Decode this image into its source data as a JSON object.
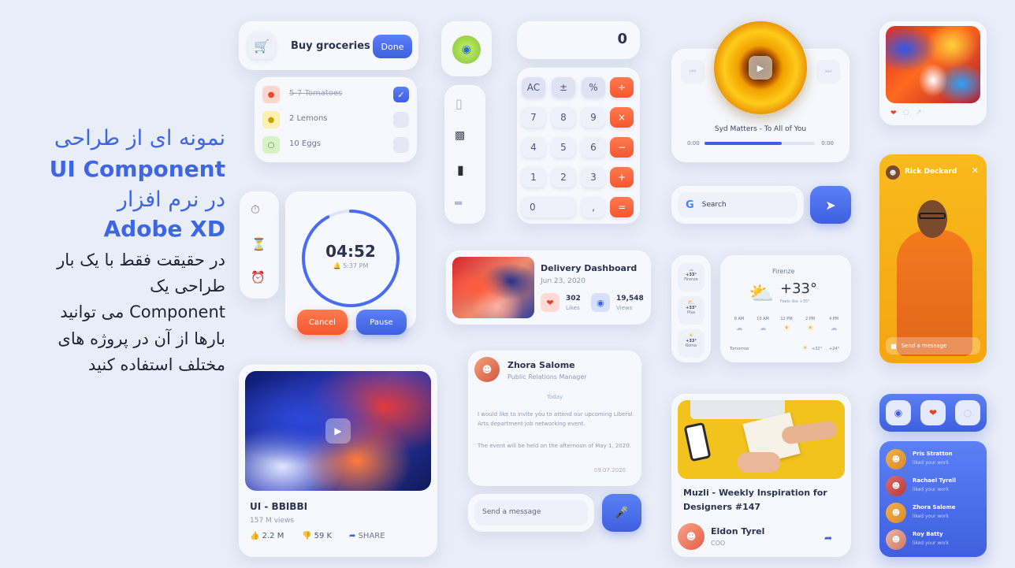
{
  "promo": {
    "line1": "نمونه ای از طراحی",
    "line2": "UI Component",
    "line3": "در نرم افزار",
    "line4": "Adobe XD",
    "line5": "در حقیقت فقط با یک بار",
    "line6": "طراحی یک",
    "line7": "Component می توانید",
    "line8": "بارها از آن در پروژه های",
    "line9": "مختلف استفاده کنید"
  },
  "todo": {
    "title": "Buy groceries",
    "done_label": "Done",
    "items": [
      {
        "label": "5-7 Tomatoes",
        "checked": true
      },
      {
        "label": "2 Lemons",
        "checked": false
      },
      {
        "label": "10 Eggs",
        "checked": false
      }
    ]
  },
  "calculator": {
    "display": "0",
    "keys": [
      "AC",
      "±",
      "%",
      "÷",
      "7",
      "8",
      "9",
      "×",
      "4",
      "5",
      "6",
      "−",
      "1",
      "2",
      "3",
      "+",
      "0",
      ",",
      "="
    ]
  },
  "timer": {
    "time": "04:52",
    "alarm": "5:37 PM",
    "cancel_label": "Cancel",
    "pause_label": "Pause",
    "progress": 0.92
  },
  "player": {
    "track": "Syd Matters - To All of You",
    "elapsed": "0:00",
    "total": "0:00",
    "progress": 0.7
  },
  "search": {
    "placeholder": "Search",
    "logo": "G"
  },
  "delivery": {
    "title": "Delivery Dashboard",
    "date": "Jun 23, 2020",
    "likes_count": "302",
    "likes_label": "Likes",
    "views_count": "19,548",
    "views_label": "Views"
  },
  "weather": {
    "city": "Firenze",
    "temp": "+33°",
    "feels": "Feels like +35°",
    "side": [
      {
        "temp": "+33°",
        "city": "Firenze"
      },
      {
        "temp": "+33°",
        "city": "Pisa"
      },
      {
        "temp": "+33°",
        "city": "Roma"
      }
    ],
    "hours": [
      "8 AM",
      "10 AM",
      "12 PM",
      "2 PM",
      "4 PM"
    ],
    "tomorrow_label": "Tomorrow",
    "tomorrow_high": "+32°",
    "tomorrow_low": "+24°"
  },
  "chat": {
    "name": "Zhora Salome",
    "role": "Public Relations Manager",
    "day": "Today",
    "message1": "I would like to invite you to attend our upcoming Liberal Arts department job networking event.",
    "message2": "The event will be held on the afternoon of May 1, 2020.",
    "date": "09.07.2020",
    "input_placeholder": "Send a message"
  },
  "video": {
    "title": "UI - BBIBBI",
    "views": "157 M views",
    "likes": "2.2 M",
    "dislikes": "59 K",
    "share": "SHARE"
  },
  "article": {
    "title": "Muzli - Weekly Inspiration for Designers #147",
    "author": "Eldon Tyrel",
    "author_role": "COO"
  },
  "story": {
    "name": "Rick Deckard",
    "input_placeholder": "Send a message"
  },
  "activity": {
    "items": [
      {
        "name": "Pris Stratton",
        "action": "liked your work"
      },
      {
        "name": "Rachael Tyrell",
        "action": "liked your work"
      },
      {
        "name": "Zhora Salome",
        "action": "liked your work"
      },
      {
        "name": "Roy Batty",
        "action": "liked your work"
      }
    ]
  }
}
